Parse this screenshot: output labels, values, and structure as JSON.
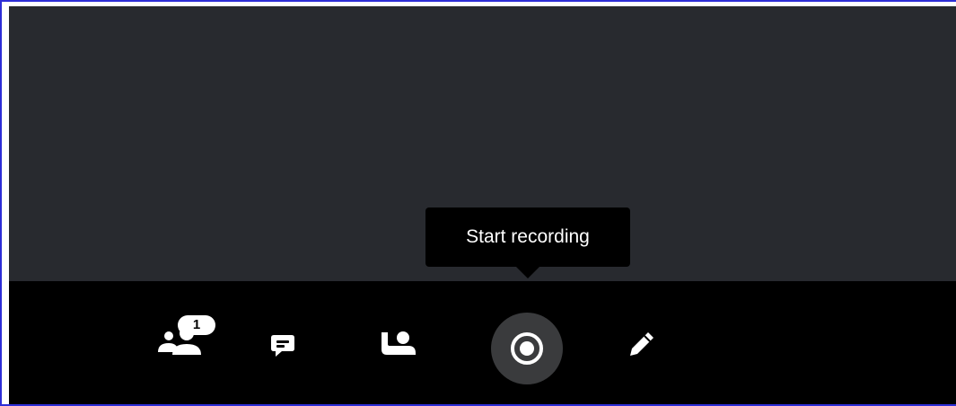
{
  "tooltip": {
    "text": "Start recording"
  },
  "toolbar": {
    "participants": {
      "icon": "participants-icon",
      "badge_count": "1"
    },
    "chat": {
      "icon": "chat-icon"
    },
    "raise_hand": {
      "icon": "raise-hand-icon"
    },
    "record": {
      "icon": "record-icon",
      "active_background": "#3a3b3d"
    },
    "whiteboard": {
      "icon": "pencil-icon"
    }
  },
  "colors": {
    "stage_background": "#282a2f",
    "toolbar_background": "#000000",
    "icon_color": "#ffffff",
    "frame_border": "#2e2ed6"
  }
}
